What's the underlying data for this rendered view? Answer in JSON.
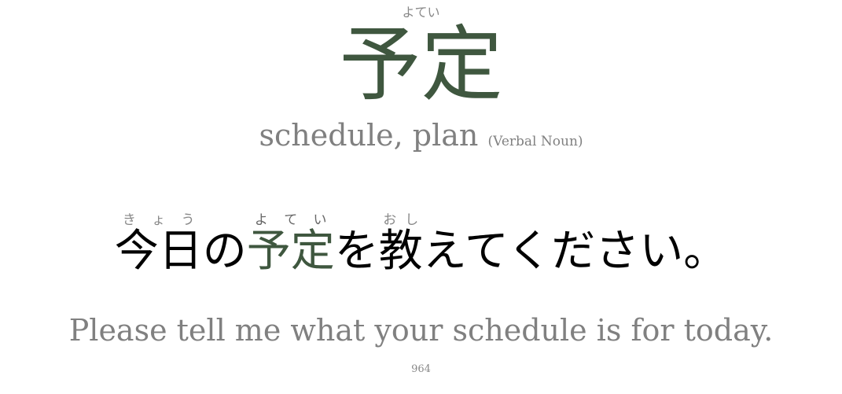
{
  "card": {
    "word": "予定",
    "word_reading": "よてい",
    "meaning": "schedule, plan",
    "part_of_speech": "(Verbal Noun)",
    "sentence": [
      {
        "text": "今日",
        "reading": "きょう"
      },
      {
        "text": "の"
      },
      {
        "text": "予定",
        "reading": "よてい",
        "highlight": true
      },
      {
        "text": "を"
      },
      {
        "text": "教",
        "reading": "おし"
      },
      {
        "text": "えてください。"
      }
    ],
    "translation": "Please tell me what your schedule is for today.",
    "number": "964",
    "accent_color": "#3f573f"
  }
}
